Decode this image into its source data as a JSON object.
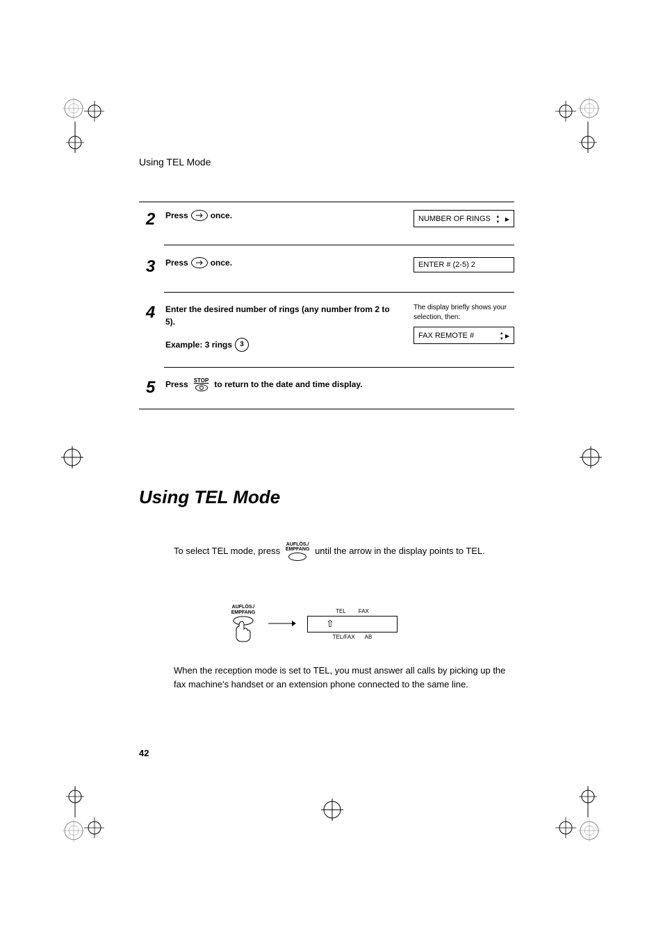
{
  "header": "Using TEL Mode",
  "steps": {
    "s2": {
      "num": "2",
      "press": "Press",
      "once": "once.",
      "display": "NUMBER OF RINGS"
    },
    "s3": {
      "num": "3",
      "press": "Press",
      "once": "once.",
      "display": "ENTER # (2-5) 2"
    },
    "s4": {
      "num": "4",
      "line1": "Enter the desired number of rings (any number from 2 to 5).",
      "example": "Example: 3 rings",
      "exampleKey": "3",
      "info": "The display briefly shows your selection, then:",
      "display": "FAX REMOTE #"
    },
    "s5": {
      "num": "5",
      "press": "Press",
      "stop": "STOP",
      "rest": "to return to the date and time display."
    }
  },
  "section": {
    "title": "Using TEL Mode",
    "prefix": "To select TEL mode, press",
    "keyLabel": "AUFLÖS./\nEMPFANG",
    "suffix": "until the arrow in the display points to TEL.",
    "body2": "When the reception mode is set to TEL, you must answer all calls by picking up the fax machine's handset or an extension phone connected to the same line."
  },
  "diagram": {
    "keyLabel1": "AUFLÖS./",
    "keyLabel2": "EMPFANG",
    "topLeft": "TEL",
    "topRight": "FAX",
    "bottomLeft": "TEL/FAX",
    "bottomRight": "AB"
  },
  "pageNumber": "42"
}
